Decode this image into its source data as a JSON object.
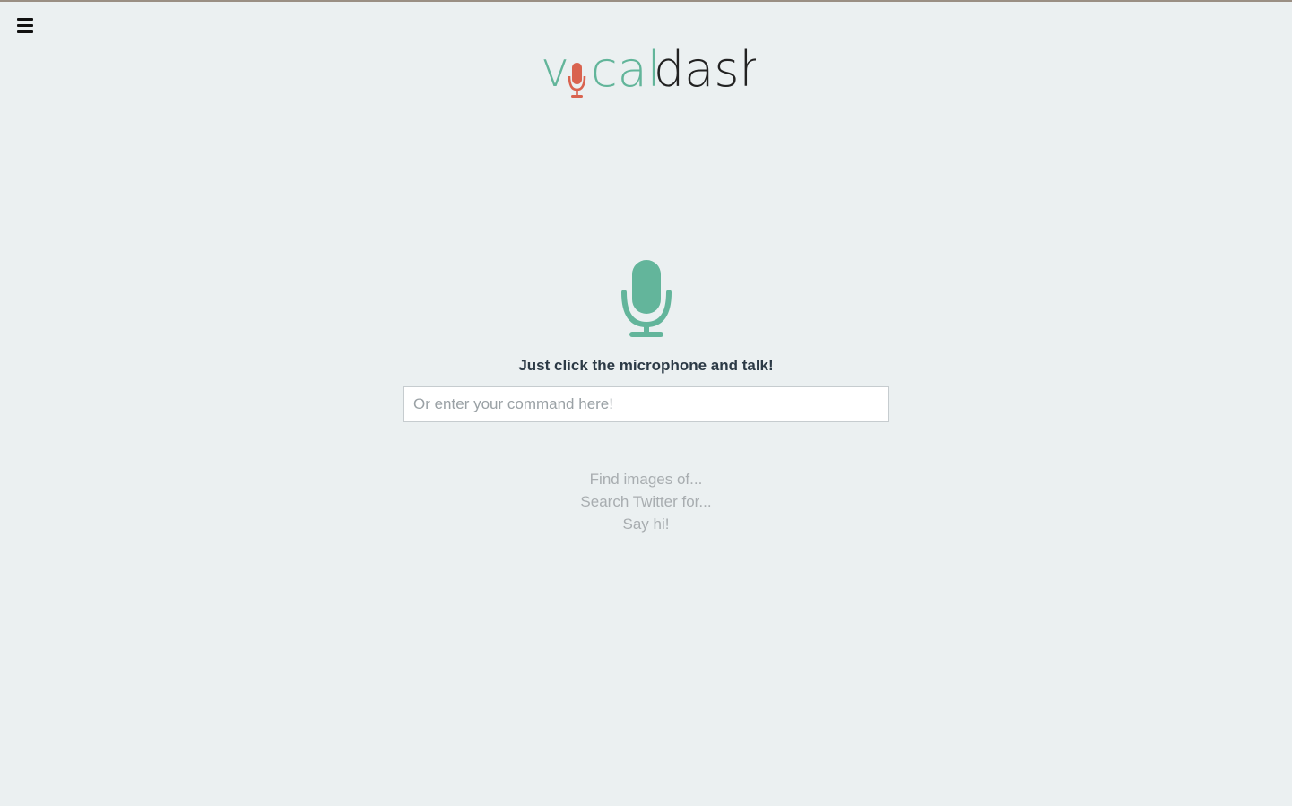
{
  "logo": {
    "prefix_before_mic": "v",
    "after_mic": "cal",
    "dark_part": "dash",
    "colors": {
      "teal": "#62b59a",
      "red": "#d9634f",
      "dark": "#222222"
    }
  },
  "menu": {
    "icon": "hamburger-menu-icon"
  },
  "main": {
    "mic_icon": "microphone-icon",
    "mic_color": "#63b59b",
    "instruction": "Just click the microphone and talk!",
    "command_placeholder": "Or enter your command here!",
    "command_value": "",
    "suggestions": [
      "Find images of...",
      "Search Twitter for...",
      "Say hi!"
    ]
  }
}
